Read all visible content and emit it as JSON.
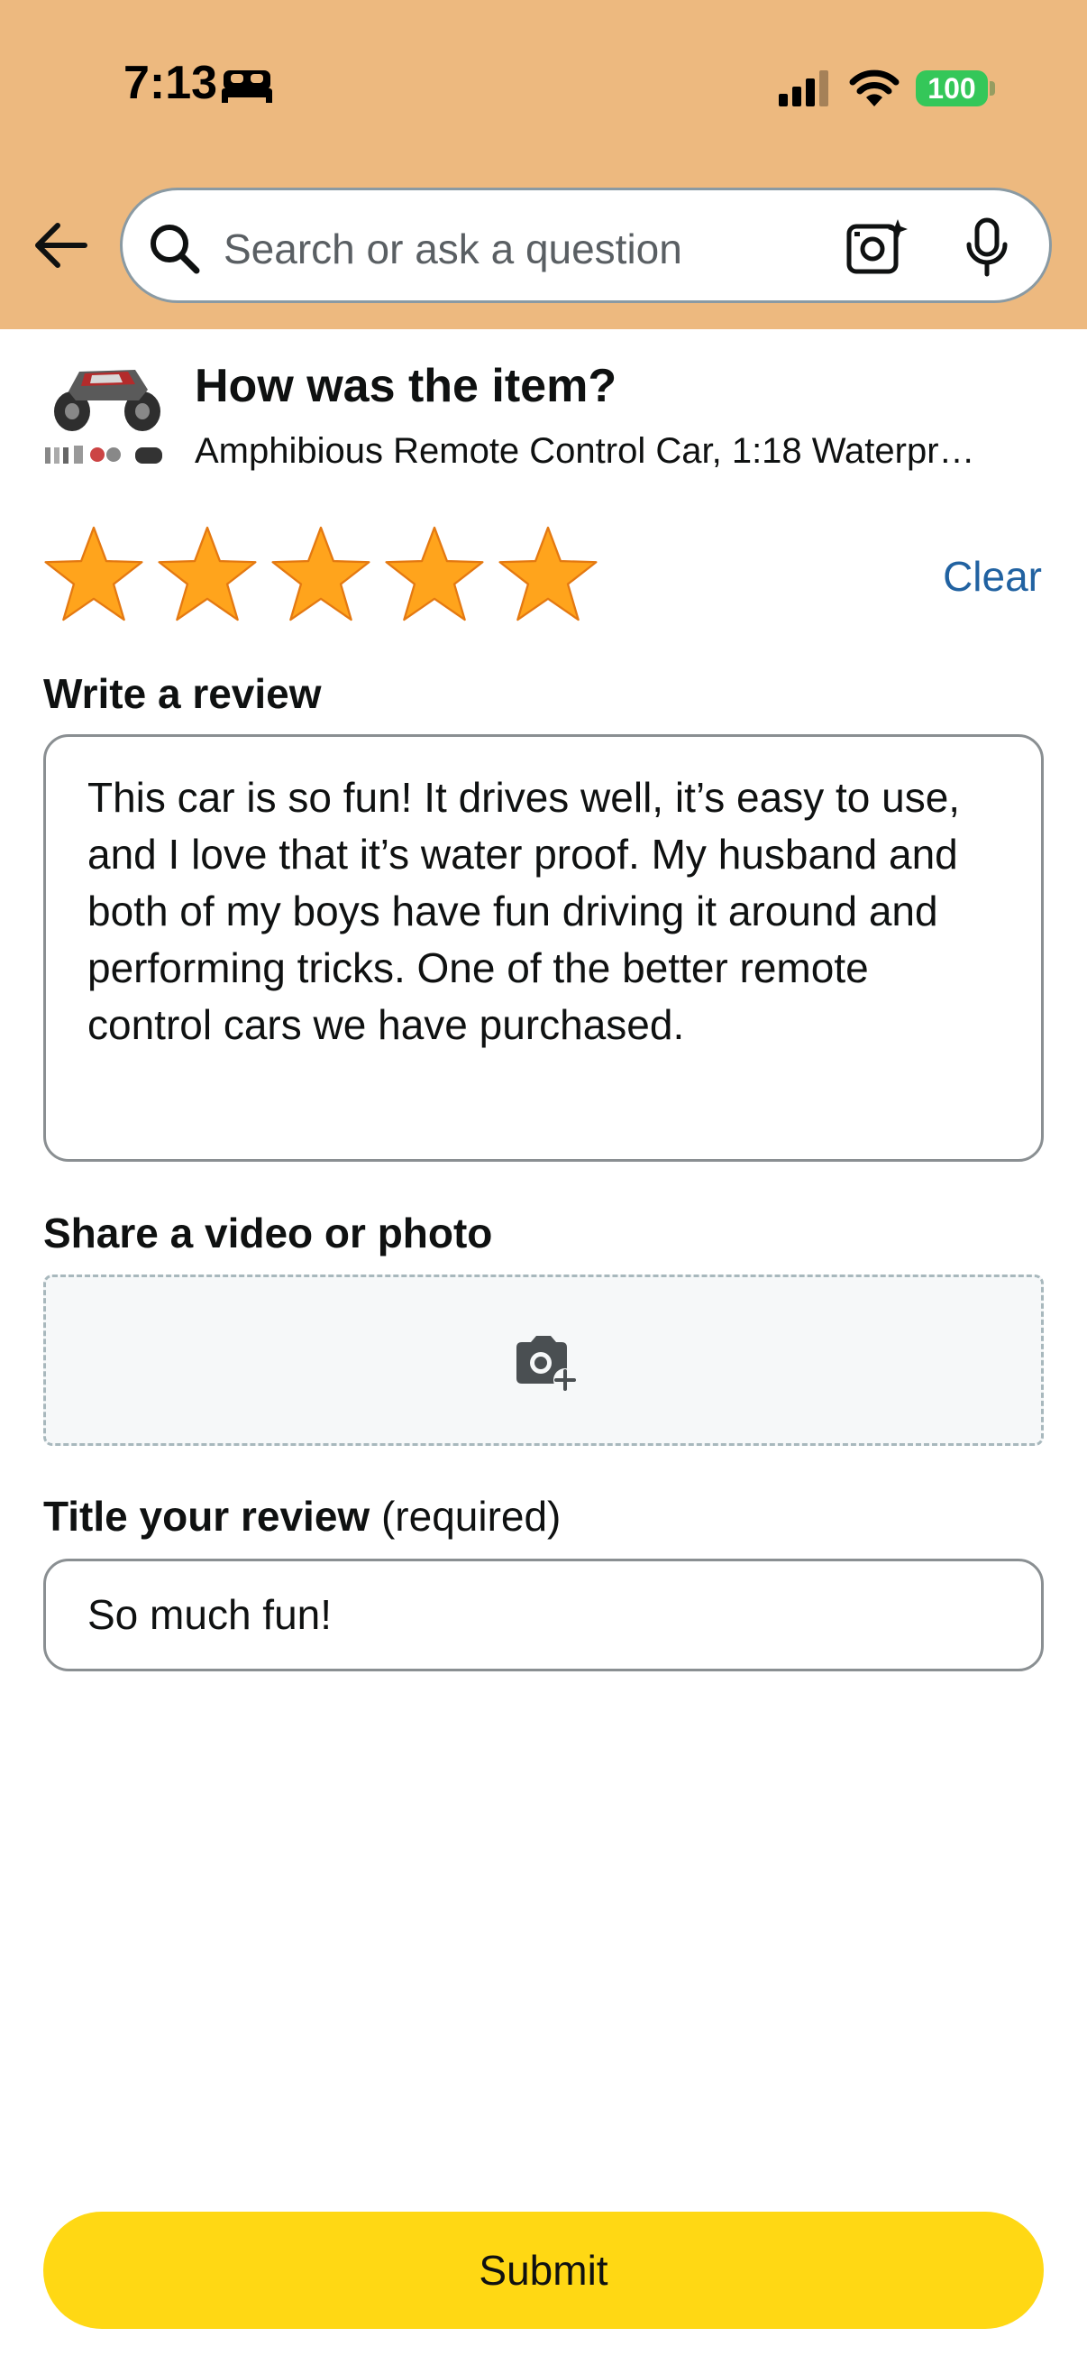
{
  "status_bar": {
    "time": "7:13",
    "battery": "100"
  },
  "search": {
    "placeholder": "Search or ask a question"
  },
  "review_form": {
    "question": "How was the item?",
    "product_name": "Amphibious Remote Control Car, 1:18 Waterpr…",
    "rating": 5,
    "rating_max": 5,
    "clear_label": "Clear",
    "write_review_label": "Write a review",
    "review_text": "This car is so fun! It drives well, it’s easy to use, and I love that it’s water proof. My husband and both of my boys have fun driving it around and performing tricks. One of the better remote control cars we have purchased.",
    "share_media_label": "Share a video or photo",
    "title_label": "Title your review",
    "title_required": "(required)",
    "title_value": "So much fun!",
    "submit_label": "Submit"
  },
  "icons": {
    "back": "back-arrow-icon",
    "search": "search-icon",
    "camera_search": "camera-search-icon",
    "mic": "microphone-icon",
    "add_photo": "add-photo-icon"
  },
  "colors": {
    "header_bg": "#EDB97F",
    "star": "#FFA41C",
    "link": "#2162A1",
    "submit_bg": "#FFD814",
    "battery": "#34C759"
  }
}
